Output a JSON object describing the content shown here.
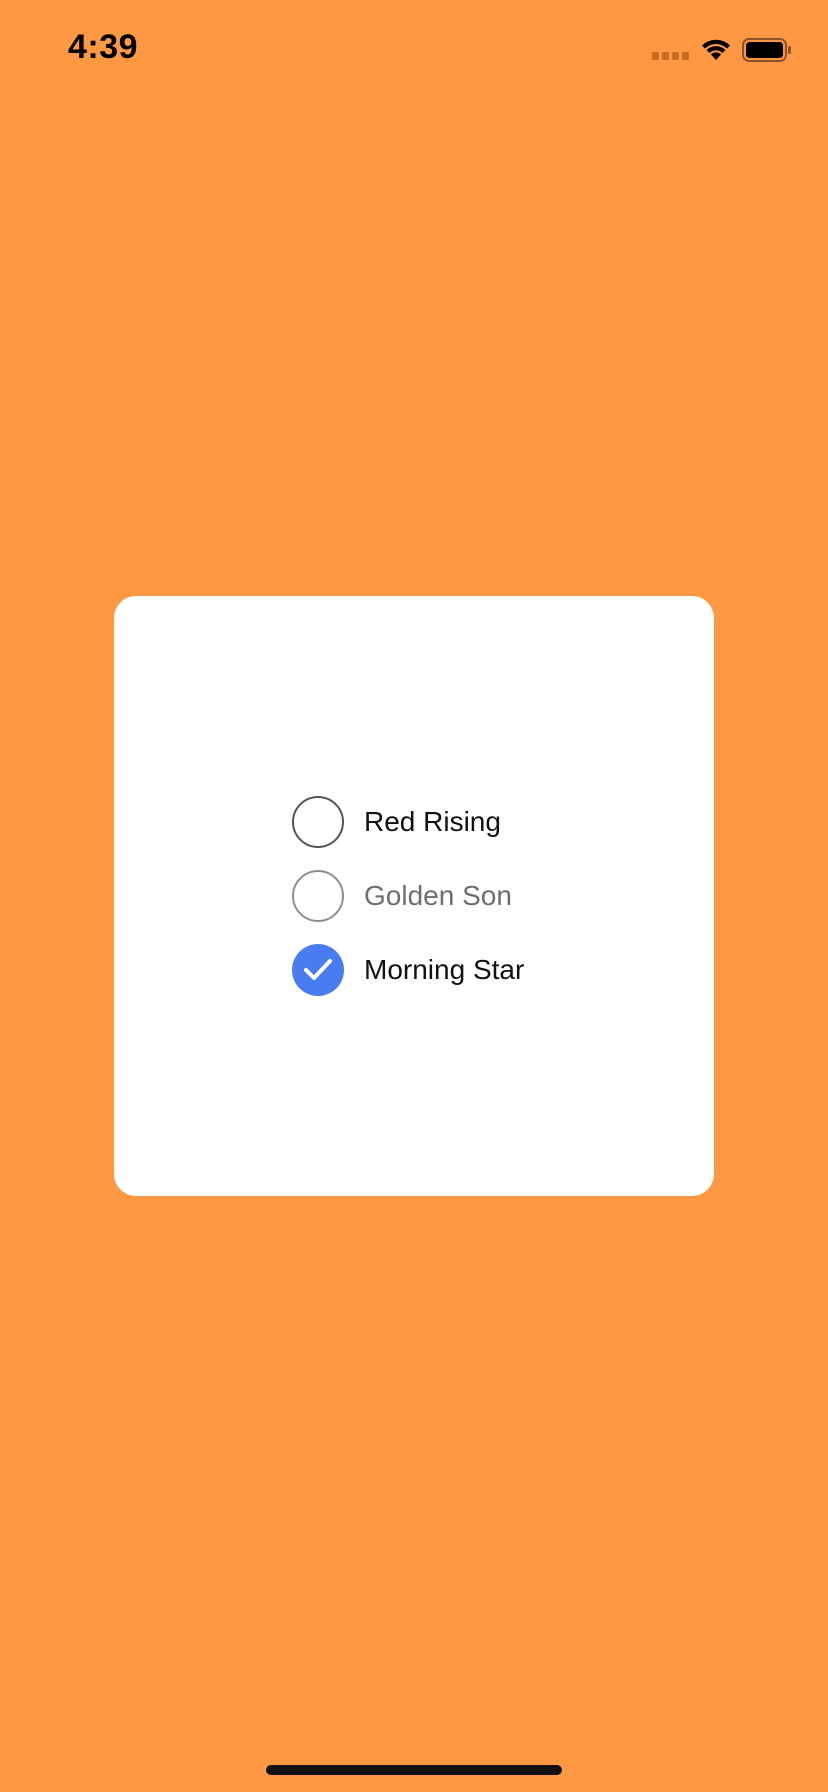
{
  "status_bar": {
    "time": "4:39",
    "icons": [
      "cellular-signal-icon",
      "wifi-icon",
      "battery-icon"
    ]
  },
  "colors": {
    "background": "#FF9843",
    "card": "#FFFFFF",
    "accent": "#4A7CF1"
  },
  "radio_group": {
    "options": [
      {
        "label": "Red Rising",
        "state": "unchecked",
        "enabled": true
      },
      {
        "label": "Golden Son",
        "state": "unchecked",
        "enabled": false
      },
      {
        "label": "Morning Star",
        "state": "checked",
        "enabled": true
      }
    ],
    "selected": "Morning Star"
  }
}
